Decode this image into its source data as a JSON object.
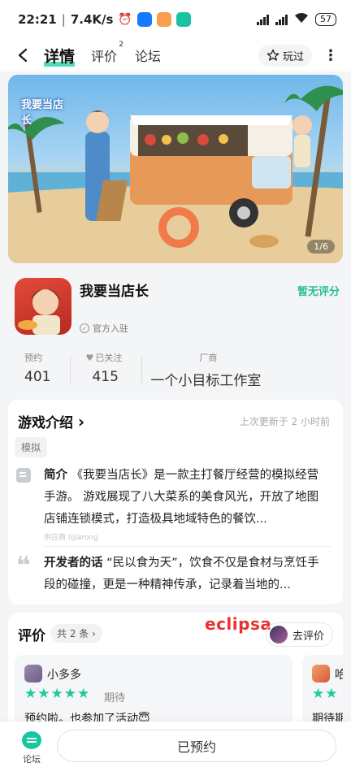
{
  "status_bar": {
    "time": "22:21",
    "speed": "7.4K/s",
    "battery": "57"
  },
  "nav": {
    "tabs": [
      {
        "label": "详情",
        "active": true
      },
      {
        "label": "评价",
        "badge": "2"
      },
      {
        "label": "论坛"
      }
    ],
    "played_label": "玩过"
  },
  "banner": {
    "counter": "1/6",
    "logo_text": "我要当店长"
  },
  "app": {
    "name": "我要当店长",
    "official": "官方入驻",
    "rating": "暂无评分",
    "stats": {
      "reserve_label": "预约",
      "reserve_value": "401",
      "follow_label": "已关注",
      "follow_value": "415",
      "dev_label": "厂商",
      "dev_value": "一个小目标工作室"
    }
  },
  "intro": {
    "title": "游戏介绍",
    "chevron": "›",
    "updated": "上次更新于 2 小时前",
    "tag": "模拟",
    "brief_label": "简介",
    "brief_text": "《我要当店长》是一款主打餐厅经营的模拟经营手游。 游戏展现了八大菜系的美食风光，开放了地图店铺连锁模式，打造极具地域特色的餐饮...",
    "supplier": "供应商 tijiarong",
    "dev_word_label": "开发者的话",
    "dev_word_text": "“民以食为天”，饮食不仅是食材与烹饪手段的碰撞，更是一种精神传承，记录着当地的..."
  },
  "reviews": {
    "title": "评价",
    "count": "共 2 条",
    "watermark": "eclipsa",
    "go_review": "去评价",
    "items": [
      {
        "user": "小多多",
        "stars": "★★★★★",
        "status": "期待",
        "text": "预约啦。也参加了活动😇"
      },
      {
        "user": "哈",
        "stars": "★★",
        "status": "",
        "text": "期待期"
      }
    ]
  },
  "bottom": {
    "forum_label": "论坛",
    "reserved_label": "已预约"
  }
}
